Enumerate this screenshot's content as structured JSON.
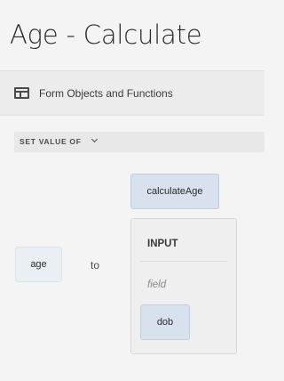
{
  "header": {
    "title": "Age - Calculate"
  },
  "toolbar": {
    "icon": "panel-layout-icon",
    "label": "Form Objects and Functions"
  },
  "rule": {
    "statement_label": "SET VALUE OF",
    "target": "age",
    "connector": "to",
    "function": "calculateAge",
    "input": {
      "heading": "INPUT",
      "param_label": "field",
      "param_value": "dob"
    }
  }
}
